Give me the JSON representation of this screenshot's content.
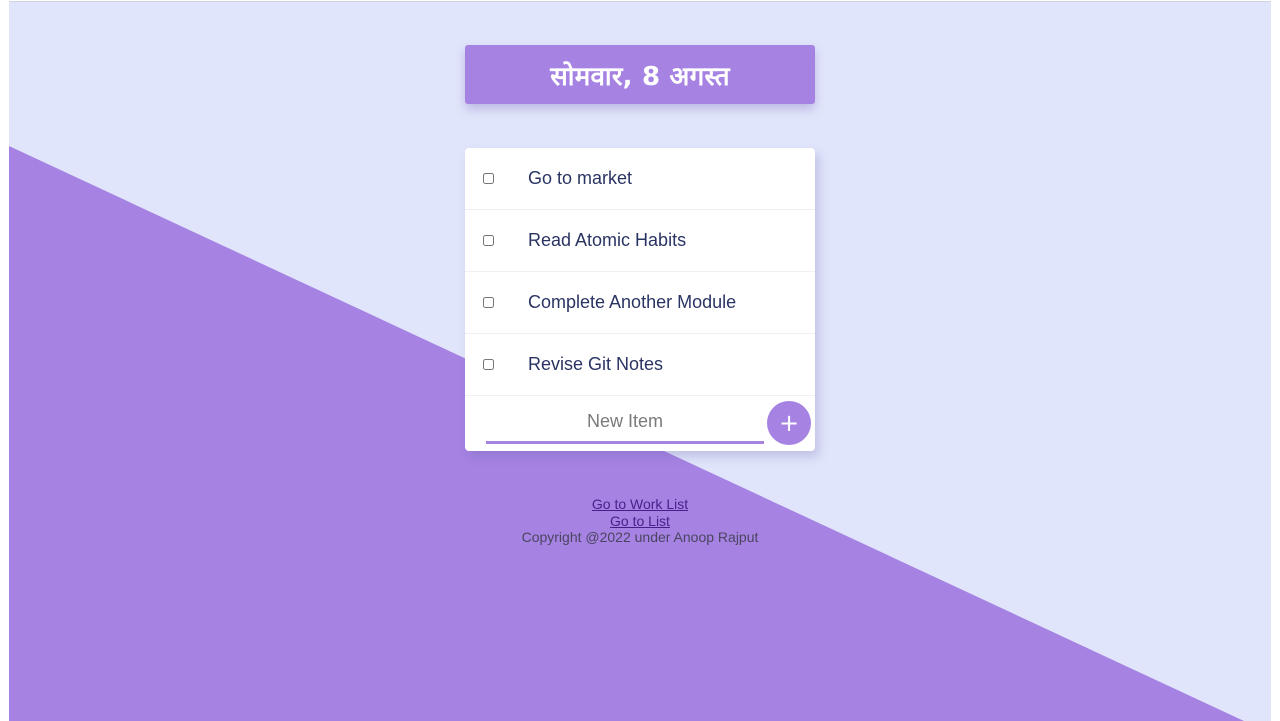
{
  "header": {
    "title": "सोमवार, 8 अगस्त"
  },
  "todo": {
    "items": [
      {
        "label": "Go to market",
        "checked": false
      },
      {
        "label": "Read Atomic Habits",
        "checked": false
      },
      {
        "label": "Complete Another Module",
        "checked": false
      },
      {
        "label": "Revise Git Notes",
        "checked": false
      }
    ],
    "new_item": {
      "placeholder": "New Item",
      "value": ""
    },
    "add_button_label": "+"
  },
  "footer": {
    "links": [
      {
        "label": "Go to Work List"
      },
      {
        "label": "Go to List"
      }
    ],
    "copyright": "Copyright @2022 under Anoop Rajput"
  },
  "colors": {
    "background": "#e0e5fb",
    "accent": "#a683e3",
    "text": "#2a3463",
    "link": "#4a1e8a"
  }
}
